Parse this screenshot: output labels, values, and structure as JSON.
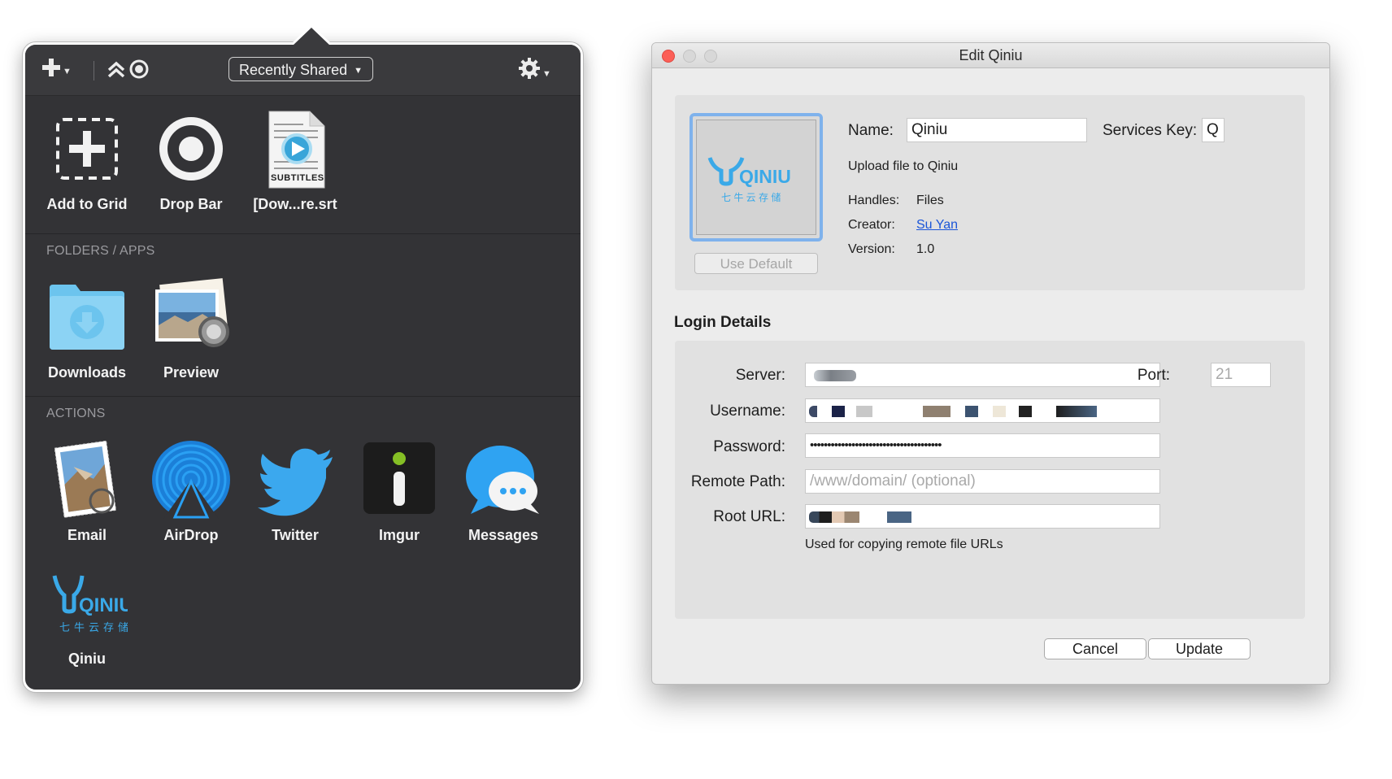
{
  "popover": {
    "toolbar": {
      "add_icon": "plus-icon",
      "collapse_icon": "double-chevron-up-icon",
      "record_icon": "record-icon",
      "dropdown_label": "Recently Shared",
      "settings_icon": "gear-icon"
    },
    "recent": [
      {
        "label": "Add to Grid",
        "icon": "dashed-plus-icon"
      },
      {
        "label": "Drop Bar",
        "icon": "ring-icon"
      },
      {
        "label": "[Dow...re.srt",
        "icon": "subtitles-file-icon",
        "badge": "SUBTITLES"
      }
    ],
    "folders_title": "FOLDERS / APPS",
    "folders": [
      {
        "label": "Downloads",
        "icon": "downloads-folder-icon"
      },
      {
        "label": "Preview",
        "icon": "preview-app-icon"
      }
    ],
    "actions_title": "ACTIONS",
    "actions": [
      {
        "label": "Email",
        "icon": "email-stamp-icon"
      },
      {
        "label": "AirDrop",
        "icon": "airdrop-icon"
      },
      {
        "label": "Twitter",
        "icon": "twitter-bird-icon"
      },
      {
        "label": "Imgur",
        "icon": "imgur-icon"
      },
      {
        "label": "Messages",
        "icon": "messages-icon"
      },
      {
        "label": "Qiniu",
        "icon": "qiniu-logo-icon"
      }
    ]
  },
  "window": {
    "title": "Edit Qiniu",
    "logo_text": "QINIU",
    "logo_subtext": "七 牛 云 存 储",
    "use_default_label": "Use Default",
    "name_label": "Name:",
    "name_value": "Qiniu",
    "services_key_label": "Services Key:",
    "services_key_value": "Q",
    "description": "Upload file to Qiniu",
    "handles_label": "Handles:",
    "handles_value": "Files",
    "creator_label": "Creator:",
    "creator_value": "Su Yan",
    "version_label": "Version:",
    "version_value": "1.0",
    "login_title": "Login Details",
    "server_label": "Server:",
    "port_label": "Port:",
    "port_placeholder": "21",
    "username_label": "Username:",
    "password_label": "Password:",
    "password_mask": "••••••••••••••••••••••••••••••••••••••",
    "remote_path_label": "Remote Path:",
    "remote_path_placeholder": "/www/domain/ (optional)",
    "root_url_label": "Root URL:",
    "root_url_hint": "Used for copying remote file URLs",
    "cancel_label": "Cancel",
    "update_label": "Update"
  }
}
